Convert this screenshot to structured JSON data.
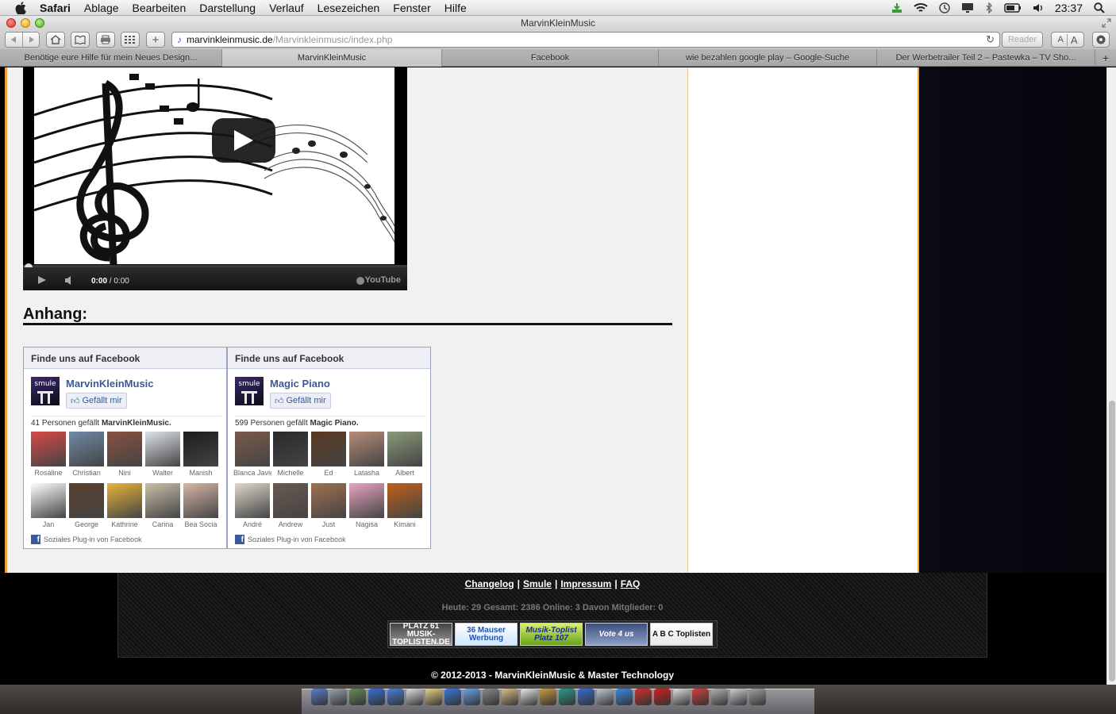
{
  "menubar": {
    "app": "Safari",
    "items": [
      "Ablage",
      "Bearbeiten",
      "Darstellung",
      "Verlauf",
      "Lesezeichen",
      "Fenster",
      "Hilfe"
    ],
    "clock": "23:37"
  },
  "window": {
    "title": "MarvinKleinMusic"
  },
  "toolbar": {
    "url_domain": "marvinkleinmusic.de",
    "url_path": "/Marvinkleinmusic/index.php",
    "reader_label": "Reader",
    "font_small": "A",
    "font_big": "A",
    "add_label": "+"
  },
  "tabs": [
    {
      "label": "Benötige eure Hilfe für mein Neues Design...",
      "active": false
    },
    {
      "label": "MarvinKleinMusic",
      "active": true
    },
    {
      "label": "Facebook",
      "active": false
    },
    {
      "label": "wie bezahlen google play – Google-Suche",
      "active": false
    },
    {
      "label": "Der Werbetrailer Teil 2 – Pastewka – TV Sho...",
      "active": false
    }
  ],
  "video": {
    "time_current": "0:00",
    "time_total": " / 0:00",
    "brand": "YouTube"
  },
  "anhang": {
    "title": "Anhang:"
  },
  "facebook": [
    {
      "header": "Finde uns auf Facebook",
      "page_name": "MarvinKleinMusic",
      "logo_text": "smule",
      "like_label": "Gefällt mir",
      "count_prefix": "41 Personen gefällt ",
      "count_page": "MarvinKleinMusic.",
      "fans": [
        {
          "name": "Rosáline",
          "color": "#d94848"
        },
        {
          "name": "Christian",
          "color": "#6f8aa6"
        },
        {
          "name": "Nini",
          "color": "#8a5040"
        },
        {
          "name": "Walter",
          "color": "#dfe3ea"
        },
        {
          "name": "Manish",
          "color": "#1c1c1c"
        },
        {
          "name": "Jan",
          "color": "#ffffff"
        },
        {
          "name": "George",
          "color": "#5a3e2a"
        },
        {
          "name": "Kathrine",
          "color": "#e8b43a"
        },
        {
          "name": "Carina",
          "color": "#cbbfa8"
        },
        {
          "name": "Bea Socia",
          "color": "#d8b6a6"
        }
      ],
      "plugin_label": "Soziales Plug-in von Facebook"
    },
    {
      "header": "Finde uns auf Facebook",
      "page_name": "Magic Piano",
      "logo_text": "smule",
      "like_label": "Gefällt mir",
      "count_prefix": "599 Personen gefällt ",
      "count_page": "Magic Piano.",
      "fans": [
        {
          "name": "Blanca Javie",
          "color": "#7a5a4a"
        },
        {
          "name": "Michelle",
          "color": "#2a2a2a"
        },
        {
          "name": "Ed",
          "color": "#5a3a22"
        },
        {
          "name": "Latasha",
          "color": "#b88c78"
        },
        {
          "name": "Albert",
          "color": "#8a9a7a"
        },
        {
          "name": "André",
          "color": "#e0d8cc"
        },
        {
          "name": "Andrew",
          "color": "#6a5a50"
        },
        {
          "name": "Just",
          "color": "#a07050"
        },
        {
          "name": "Nagisa",
          "color": "#e8a4c0"
        },
        {
          "name": "Kimani",
          "color": "#c06018"
        }
      ],
      "plugin_label": "Soziales Plug-in von Facebook"
    }
  ],
  "footer": {
    "links": [
      "Changelog",
      "Smule",
      "Impressum",
      "FAQ"
    ],
    "separator": "|",
    "stats": "Heute: 29 Gesamt: 2386 Online: 3 Davon Mitglieder: 0",
    "badges": [
      {
        "text": "PLATZ 61 MUSIK-TOPLISTEN.DE"
      },
      {
        "text": "36 Mauser Werbung"
      },
      {
        "text": "Musik-Toplist Platz 107"
      },
      {
        "text": "Vote 4 us"
      },
      {
        "text": "A B C Toplisten"
      }
    ],
    "copyright": "© 2012-2013 - MarvinKleinMusic & Master Technology"
  },
  "dock": {
    "icon_colors": [
      "#5b7fc9",
      "#9aa2aa",
      "#6a8a5a",
      "#3a6fd0",
      "#4a7fd8",
      "#e0e0e0",
      "#e8d488",
      "#3a78d8",
      "#6aa0e8",
      "#888888",
      "#d8c088",
      "#e8e8e8",
      "#c89a40",
      "#2a9a8a",
      "#3a6ad0",
      "#c0c8d0",
      "#3a8ae0",
      "#d03030",
      "#cc2020",
      "#e0e0e0",
      "#d04040",
      "#b0b0b0",
      "#d0d0d0",
      "#a0a0a0"
    ]
  },
  "colors": {
    "accent_orange": "#f0a030",
    "facebook_blue": "#3b5998"
  }
}
